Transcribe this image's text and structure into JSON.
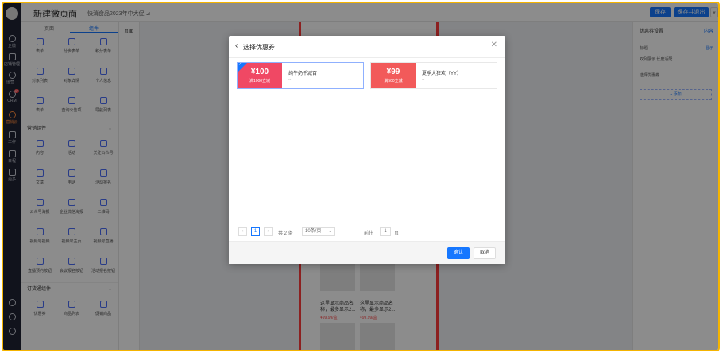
{
  "header": {
    "title": "新建微页面",
    "subtitle": "快消食品2023年中大促 ⊿",
    "save_label": "保存",
    "save_exit_label": "保存并退出"
  },
  "rail": {
    "items": [
      {
        "label": "企微",
        "icon": "circle-icon"
      },
      {
        "label": "店铺管理",
        "icon": "store-icon"
      },
      {
        "label": "运营...",
        "icon": "cube-icon"
      },
      {
        "label": "CRM",
        "icon": "crm-icon",
        "badge": "37"
      },
      {
        "label": "营销云",
        "icon": "cloud-icon",
        "active": true
      },
      {
        "label": "工作",
        "icon": "work-icon"
      },
      {
        "label": "日程",
        "icon": "calendar-icon"
      },
      {
        "label": "更多",
        "icon": "grid-icon"
      }
    ]
  },
  "comps": {
    "tab_page": "页面",
    "tab_comp": "组件",
    "group1": [
      "表单",
      "分步表单",
      "积分表单",
      "对象列表",
      "对象详情",
      "个人信息",
      "表单",
      "查询公告项",
      "导航列表"
    ],
    "section_marketing": "营销组件",
    "group2": [
      "内容",
      "活动",
      "关注公众号",
      "文章",
      "电话",
      "活动报名",
      "公众号海报",
      "企业微信海报",
      "二维码",
      "视频号视频",
      "视频号主页",
      "视频号直播",
      "直播预约按钮",
      "会议报名按钮",
      "活动报名按钮"
    ],
    "section_order": "订货通组件",
    "group3": [
      "优惠券",
      "商品列表",
      "促销商品"
    ]
  },
  "pages_label": "页面",
  "canvas": {
    "product_caption": "这里显示商品名称，最多显示2...",
    "product_price": "¥99.99/盒"
  },
  "settings": {
    "title": "优惠券设置",
    "tab": "内容",
    "row1": "标题",
    "toggle": "显示",
    "row2": "双列展示 长度适配",
    "row3": "选择优惠券",
    "add": "+ 添加"
  },
  "modal": {
    "title": "选择优惠券",
    "coupons": [
      {
        "amount": "¥100",
        "condition": "满1000立减",
        "name": "纯牛奶千减百",
        "dash": "--",
        "selected": true
      },
      {
        "amount": "¥99",
        "condition": "满500立减",
        "name": "夏季大狂欢（YY）",
        "dash": "--",
        "selected": false
      }
    ],
    "pager": {
      "prev": "‹",
      "page": "1",
      "next": "›",
      "total": "共 2 条",
      "size": "10条/页",
      "goto_label": "前往",
      "goto_value": "1",
      "goto_suffix": "页"
    },
    "ok_label": "确认",
    "cancel_label": "取消"
  }
}
